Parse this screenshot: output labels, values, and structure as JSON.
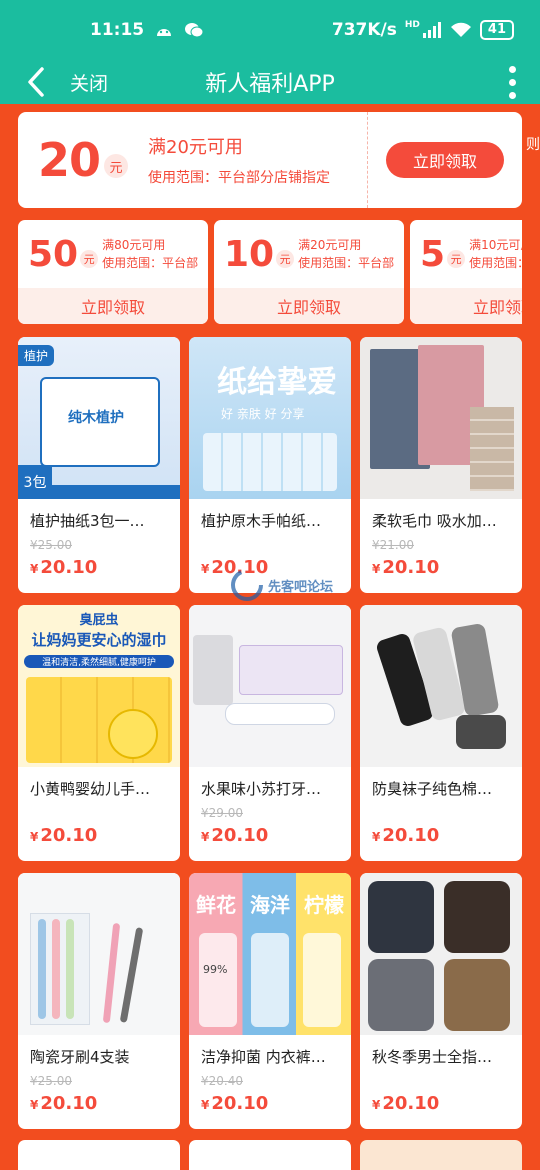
{
  "status": {
    "time": "11:15",
    "net_speed": "737K/s",
    "battery": "41",
    "network": "HD"
  },
  "nav": {
    "close": "关闭",
    "title": "新人福利APP"
  },
  "main_coupon": {
    "amount": "20",
    "unit": "元",
    "condition": "满20元可用",
    "scope": "使用范围：平台部分店铺指定",
    "button": "立即领取"
  },
  "side_edge_text": "则",
  "small_coupons": [
    {
      "amount": "50",
      "unit": "元",
      "condition": "满80元可用",
      "scope": "使用范围：平台部",
      "button": "立即领取"
    },
    {
      "amount": "10",
      "unit": "元",
      "condition": "满20元可用",
      "scope": "使用范围：平台部",
      "button": "立即领取"
    },
    {
      "amount": "5",
      "unit": "元",
      "condition": "满10元可用",
      "scope": "使用范围：平台部",
      "button": "立即领取"
    }
  ],
  "currency": "¥",
  "products": [
    {
      "name": "植护抽纸3包一…",
      "orig": "¥25.00",
      "price": "20.10",
      "img_text": [
        "植护",
        "纯木植护",
        "3包"
      ]
    },
    {
      "name": "植护原木手帕纸…",
      "orig": "",
      "price": "20.10",
      "img_text": [
        "纸给挚爱",
        "好 亲肤 好 分享"
      ]
    },
    {
      "name": "柔软毛巾 吸水加…",
      "orig": "¥21.00",
      "price": "20.10",
      "img_text": []
    },
    {
      "name": "小黄鸭婴幼儿手…",
      "orig": "",
      "price": "20.10",
      "img_text": [
        "臭屁虫",
        "让妈妈更安心的湿巾",
        "温和清洁,柔然细腻,健康呵护"
      ]
    },
    {
      "name": "水果味小苏打牙…",
      "orig": "¥29.00",
      "price": "20.10",
      "img_text": []
    },
    {
      "name": "防臭袜子纯色棉…",
      "orig": "",
      "price": "20.10",
      "img_text": []
    },
    {
      "name": "陶瓷牙刷4支装",
      "orig": "¥25.00",
      "price": "20.10",
      "img_text": []
    },
    {
      "name": "洁净抑菌 内衣裤…",
      "orig": "¥20.40",
      "price": "20.10",
      "img_text": [
        "鲜花",
        "海洋",
        "柠檬",
        "99%"
      ]
    },
    {
      "name": "秋冬季男士全指…",
      "orig": "",
      "price": "20.10",
      "img_text": []
    }
  ],
  "watermark": "先客吧论坛",
  "colors": {
    "teal": "#1bbd9f",
    "background": "#f24d1f",
    "accent": "#f44b3b"
  }
}
